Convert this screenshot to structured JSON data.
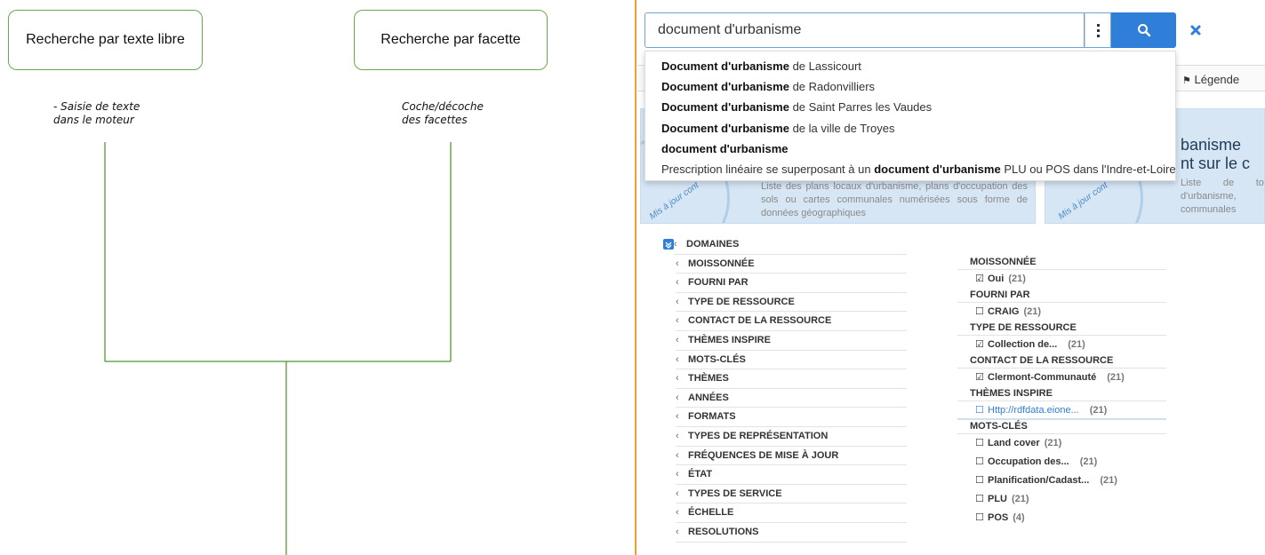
{
  "diagram": {
    "box_free_text": "Recherche par texte libre",
    "box_facet": "Recherche par facette",
    "note_free_text": [
      "- Saisie de texte",
      "dans le moteur"
    ],
    "note_facet": [
      "Coche/décoche",
      "des facettes"
    ]
  },
  "search": {
    "value": "document d'urbanisme",
    "suggestions": [
      {
        "bold": "Document d'urbanisme",
        "rest": " de Lassicourt"
      },
      {
        "bold": "Document d'urbanisme",
        "rest": " de Radonvilliers"
      },
      {
        "bold": "Document d'urbanisme",
        "rest": " de Saint Parres les Vaudes"
      },
      {
        "bold": "Document d'urbanisme",
        "rest": " de la ville de Troyes"
      },
      {
        "bold": "document d'urbanisme",
        "rest": ""
      },
      {
        "pre": "Prescription linéaire se superposant à un ",
        "bold": "document d'urbanisme",
        "rest": " PLU ou POS dans l'Indre-et-Loire"
      }
    ],
    "icons": {
      "more": "kebab-icon",
      "search": "search-icon",
      "clear": "close-icon"
    }
  },
  "background": {
    "legend": "Légende",
    "card1_text": "Liste des plans locaux d'urbanisme, plans d'occupation des sols ou cartes communales numérisées sous forme de données géographiques",
    "card2_title_1": "banisme",
    "card2_title_2": "nt sur le c",
    "card2_text": "Liste de tou d'urbanisme, communales",
    "stamp": "Mis à jour cont"
  },
  "facets_left": [
    "DOMAINES",
    "MOISSONNÉE",
    "FOURNI PAR",
    "TYPE DE RESSOURCE",
    "CONTACT DE LA RESSOURCE",
    "THÈMES INSPIRE",
    "MOTS-CLÉS",
    "THÈMES",
    "ANNÉES",
    "FORMATS",
    "TYPES DE REPRÉSENTATION",
    "FRÉQUENCES DE MISE À JOUR",
    "ÉTAT",
    "TYPES DE SERVICE",
    "ÉCHELLE",
    "RESOLUTIONS"
  ],
  "facets_right": [
    {
      "title": "MOISSONNÉE",
      "items": [
        {
          "checked": true,
          "label": "Oui",
          "count": "(21)"
        }
      ]
    },
    {
      "title": "FOURNI PAR",
      "items": [
        {
          "checked": false,
          "label": "CRAIG",
          "count": "(21)"
        }
      ]
    },
    {
      "title": "TYPE DE RESSOURCE",
      "items": [
        {
          "checked": true,
          "label": "Collection de...",
          "count": "(21)"
        }
      ]
    },
    {
      "title": "CONTACT DE LA RESSOURCE",
      "items": [
        {
          "checked": true,
          "label": "Clermont-Communauté",
          "count": "(21)"
        }
      ]
    },
    {
      "title": "THÈMES INSPIRE",
      "items": [
        {
          "checked": false,
          "label": "Http://rdfdata.eione...",
          "count": "(21)",
          "link": true
        }
      ]
    },
    {
      "title": "MOTS-CLÉS",
      "items": [
        {
          "checked": false,
          "label": "Land cover",
          "count": "(21)"
        },
        {
          "checked": false,
          "label": "Occupation des...",
          "count": "(21)"
        },
        {
          "checked": false,
          "label": "Planification/Cadast...",
          "count": "(21)"
        },
        {
          "checked": false,
          "label": "PLU",
          "count": "(21)"
        },
        {
          "checked": false,
          "label": "POS",
          "count": "(4)"
        }
      ]
    }
  ],
  "colors": {
    "diagram_green": "#6aa84f",
    "accent_blue": "#2f7ed8",
    "divider_orange": "#f0a030"
  }
}
